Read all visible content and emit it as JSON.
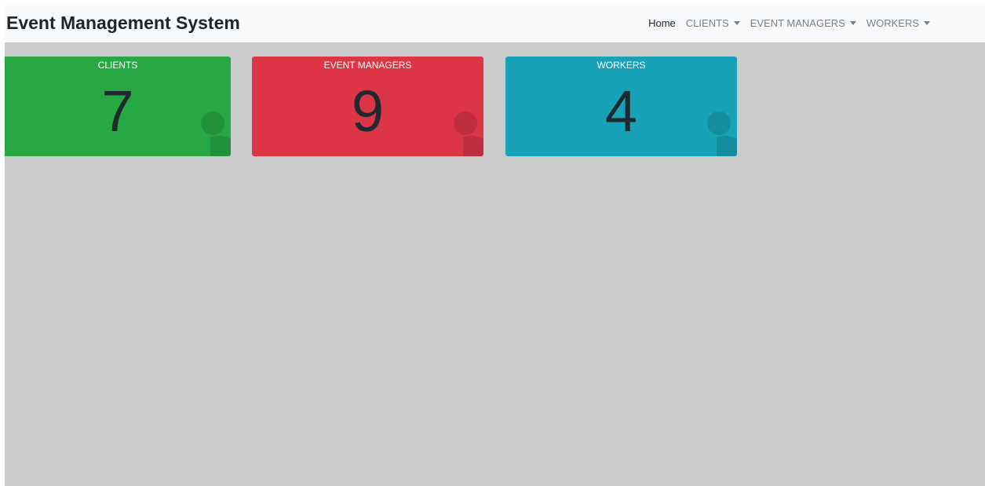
{
  "header": {
    "brand": "Event Management System",
    "nav": [
      {
        "label": "Home",
        "active": true,
        "dropdown": false
      },
      {
        "label": "CLIENTS",
        "active": false,
        "dropdown": true
      },
      {
        "label": "EVENT MANAGERS",
        "active": false,
        "dropdown": true
      },
      {
        "label": "WORKERS",
        "active": false,
        "dropdown": true
      }
    ]
  },
  "cards": [
    {
      "title": "CLIENTS",
      "count": "7",
      "color": "#28a745",
      "icon": "user-icon"
    },
    {
      "title": "EVENT MANAGERS",
      "count": "9",
      "color": "#dc3545",
      "icon": "user-icon"
    },
    {
      "title": "WORKERS",
      "count": "4",
      "color": "#17a2b8",
      "icon": "user-icon"
    }
  ],
  "colors": {
    "background": "#cbcbcb",
    "navbar": "#f8f9fa"
  }
}
